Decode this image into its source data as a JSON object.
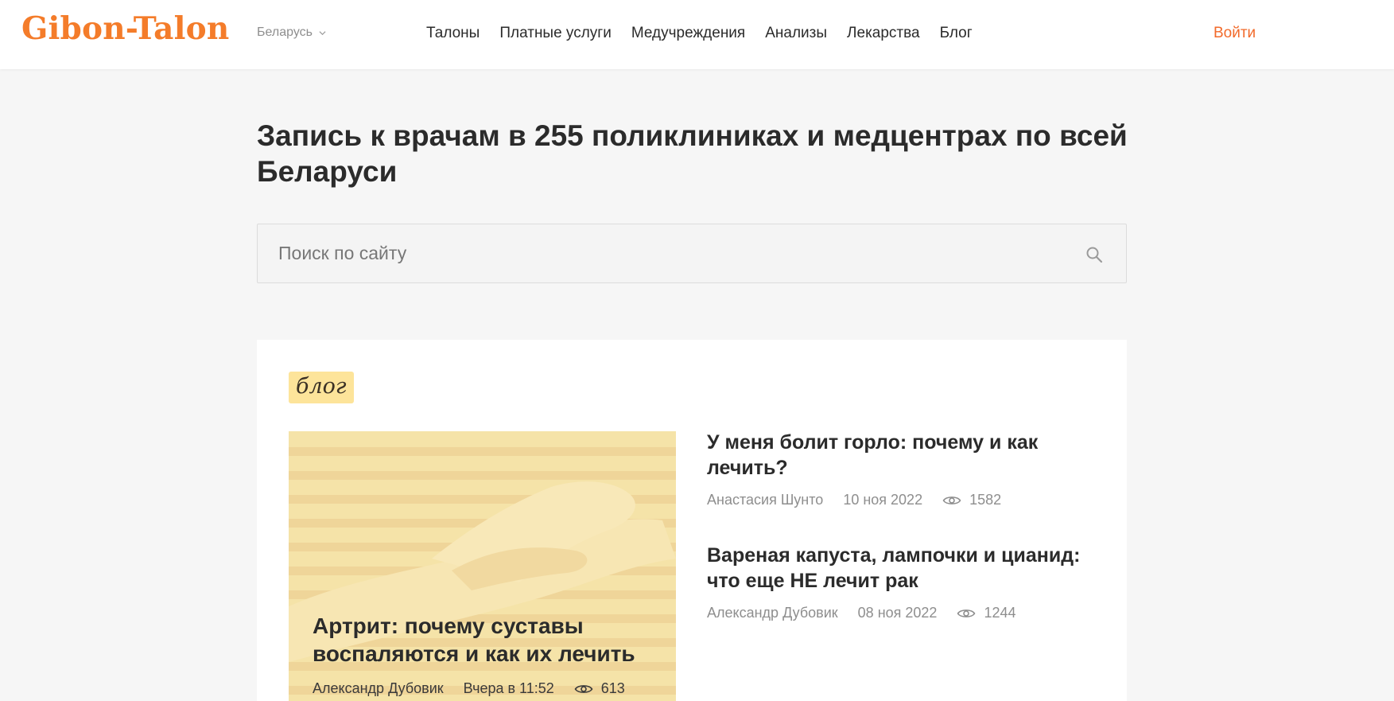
{
  "header": {
    "logo": "Gibon-Talon",
    "region": "Беларусь",
    "nav": [
      "Талоны",
      "Платные услуги",
      "Медучреждения",
      "Анализы",
      "Лекарства",
      "Блог"
    ],
    "login": "Войти"
  },
  "hero": {
    "title": "Запись к врачам в 255 поликлиниках и медцентрах по всей Беларуси"
  },
  "search": {
    "placeholder": "Поиск по сайту",
    "icon": "search-icon"
  },
  "blog": {
    "tag": "блог",
    "featured": {
      "title": "Артрит: почему суставы воспаляются и как их лечить",
      "author": "Александр Дубовик",
      "date": "Вчера в 11:52",
      "views": "613"
    },
    "articles": [
      {
        "title": "У меня болит горло: почему и как лечить?",
        "author": "Анастасия Шунто",
        "date": "10 ноя 2022",
        "views": "1582"
      },
      {
        "title": "Вареная капуста, лампочки и цианид: что еще НЕ лечит рак",
        "author": "Александр Дубовик",
        "date": "08 ноя 2022",
        "views": "1244"
      }
    ]
  },
  "colors": {
    "brand": "#f47c2a",
    "login": "#f26a2a",
    "tag_bg": "#fde49a",
    "page_bg": "#f6f6f6"
  }
}
